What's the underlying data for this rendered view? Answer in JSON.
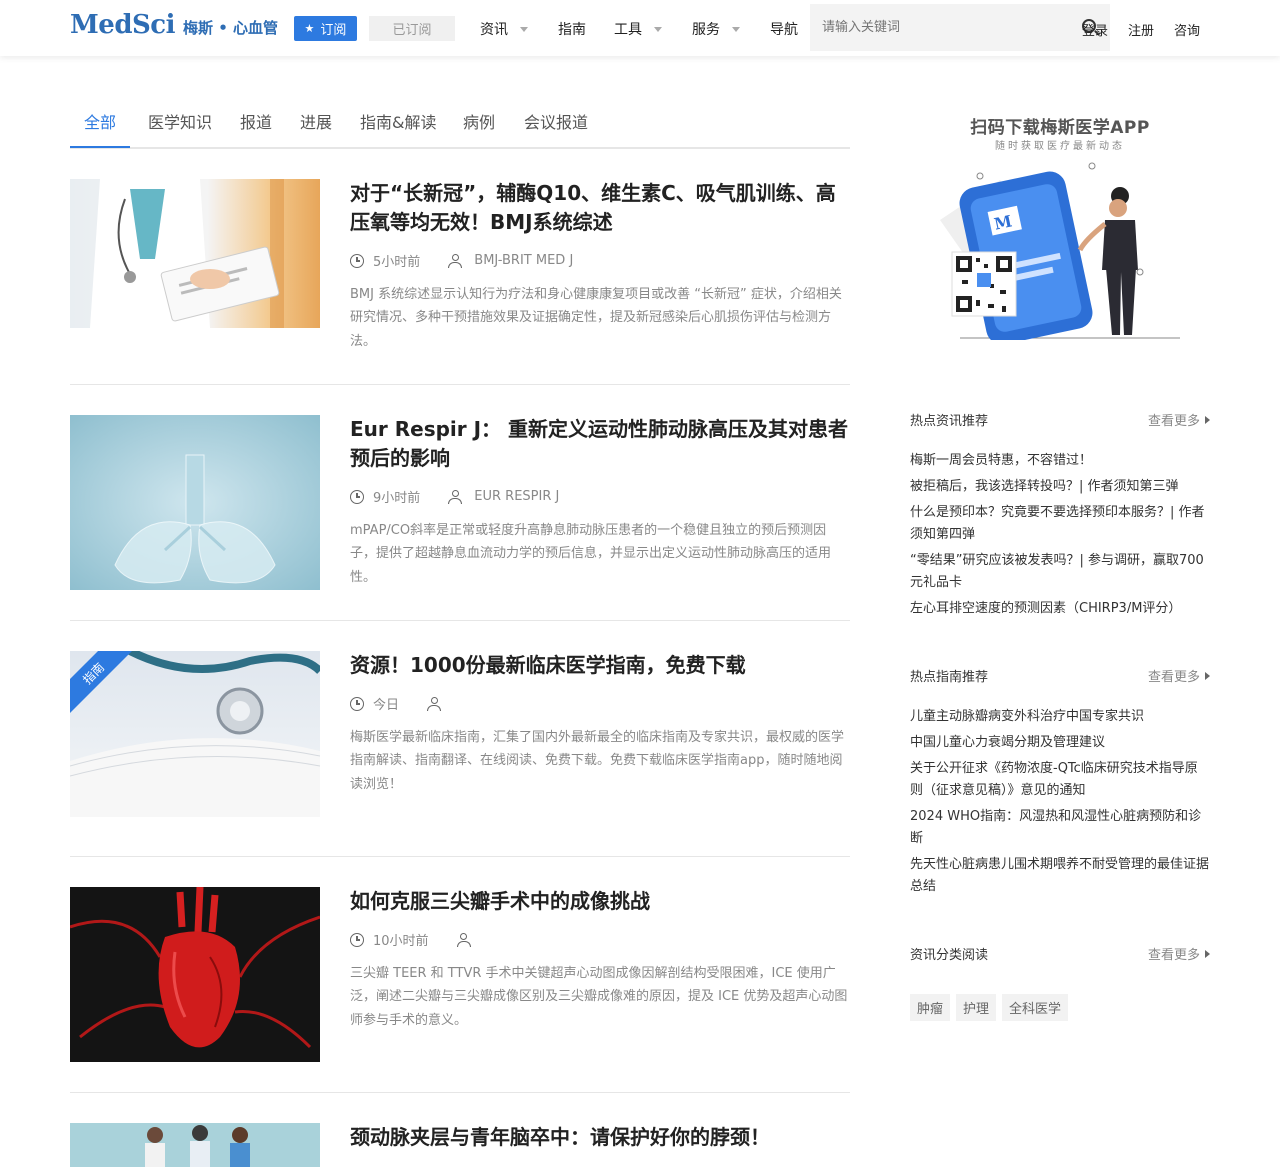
{
  "header": {
    "logo_main": "MedSci",
    "logo_sub": "梅斯 • 心血管",
    "subscribe_label": "订阅",
    "subscribed_label": "已订阅",
    "nav": [
      {
        "label": "资讯",
        "dropdown": true
      },
      {
        "label": "指南",
        "dropdown": false
      },
      {
        "label": "工具",
        "dropdown": true
      },
      {
        "label": "服务",
        "dropdown": true
      },
      {
        "label": "导航",
        "dropdown": false
      }
    ],
    "search_placeholder": "请输入关键词",
    "login": "登录",
    "register": "注册",
    "consult": "咨询"
  },
  "tabs": [
    "全部",
    "医学知识",
    "报道",
    "进展",
    "指南&解读",
    "病例",
    "会议报道"
  ],
  "active_tab": 0,
  "articles": [
    {
      "title": "对于“长新冠”，辅酶Q10、维生素C、吸气肌训练、高压氧等均无效！BMJ系统综述",
      "time": "5小时前",
      "author": "BMJ-BRIT MED J",
      "desc": "BMJ 系统综述显示认知行为疗法和身心健康康复项目或改善 “长新冠” 症状，介绍相关研究情况、多种干预措施效果及证据确定性，提及新冠感染后心肌损伤评估与检测方法。"
    },
    {
      "title": "Eur Respir J： 重新定义运动性肺动脉高压及其对患者预后的影响",
      "time": "9小时前",
      "author": "EUR RESPIR J",
      "desc": "mPAP/CO斜率是正常或轻度升高静息肺动脉压患者的一个稳健且独立的预后预测因子，提供了超越静息血流动力学的预后信息，并显示出定义运动性肺动脉高压的适用性。"
    },
    {
      "title": "资源！1000份最新临床医学指南，免费下载",
      "time": "今日",
      "author": "",
      "badge": "指南",
      "desc": "梅斯医学最新临床指南，汇集了国内外最新最全的临床指南及专家共识，最权威的医学指南解读、指南翻译、在线阅读、免费下载。免费下载临床医学指南app，随时随地阅读浏览！"
    },
    {
      "title": "如何克服三尖瓣手术中的成像挑战",
      "time": "10小时前",
      "author": "",
      "desc": "三尖瓣 TEER 和 TTVR 手术中关键超声心动图成像因解剖结构受限困难，ICE 使用广泛，阐述二尖瓣与三尖瓣成像区别及三尖瓣成像难的原因，提及 ICE 优势及超声心动图师参与手术的意义。"
    },
    {
      "title": "颈动脉夹层与青年脑卒中：请保护好你的脖颈！",
      "time": "",
      "author": "",
      "desc": ""
    }
  ],
  "sidebar": {
    "qr_title": "扫码下载梅斯医学APP",
    "qr_sub": "随时获取医疗最新动态",
    "more_label": "查看更多",
    "hot_news_title": "热点资讯推荐",
    "hot_news": [
      "梅斯一周会员特惠，不容错过！",
      "被拒稿后，我该选择转投吗？| 作者须知第三弹",
      "什么是预印本？究竟要不要选择预印本服务？| 作者须知第四弹",
      "“零结果”研究应该被发表吗？| 参与调研，赢取700元礼品卡",
      "左心耳排空速度的预测因素（CHIRP3/M评分）"
    ],
    "hot_guides_title": "热点指南推荐",
    "hot_guides": [
      "儿童主动脉瓣病变外科治疗中国专家共识",
      "中国儿童心力衰竭分期及管理建议",
      "关于公开征求《药物浓度-QTc临床研究技术指导原则（征求意见稿）》意见的通知",
      "2024 WHO指南：风湿热和风湿性心脏病预防和诊断",
      "先天性心脏病患儿围术期喂养不耐受管理的最佳证据总结"
    ],
    "category_title": "资讯分类阅读",
    "tags": [
      "肿瘤",
      "护理",
      "全科医学"
    ]
  },
  "colors": {
    "accent": "#2d7ae0",
    "brand": "#2e6db4"
  }
}
